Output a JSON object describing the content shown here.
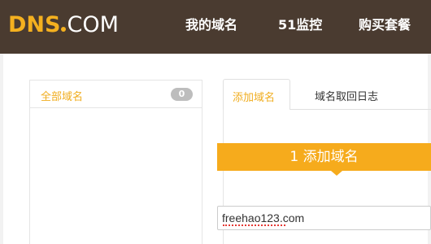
{
  "header": {
    "logo_left": "DNS",
    "logo_right": "COM",
    "nav": [
      "我的域名",
      "51监控",
      "购买套餐"
    ]
  },
  "sidebar": {
    "all_domains_label": "全部域名",
    "all_domains_count": "0"
  },
  "tabs": [
    {
      "label": "添加域名",
      "active": true
    },
    {
      "label": "域名取回日志",
      "active": false
    }
  ],
  "step": {
    "title": "1 添加域名"
  },
  "domain_input": {
    "value": "freehao123.com"
  },
  "colors": {
    "header_bg": "#4a3b30",
    "accent": "#f6ab1c",
    "badge_gray": "#bdbdbd"
  }
}
